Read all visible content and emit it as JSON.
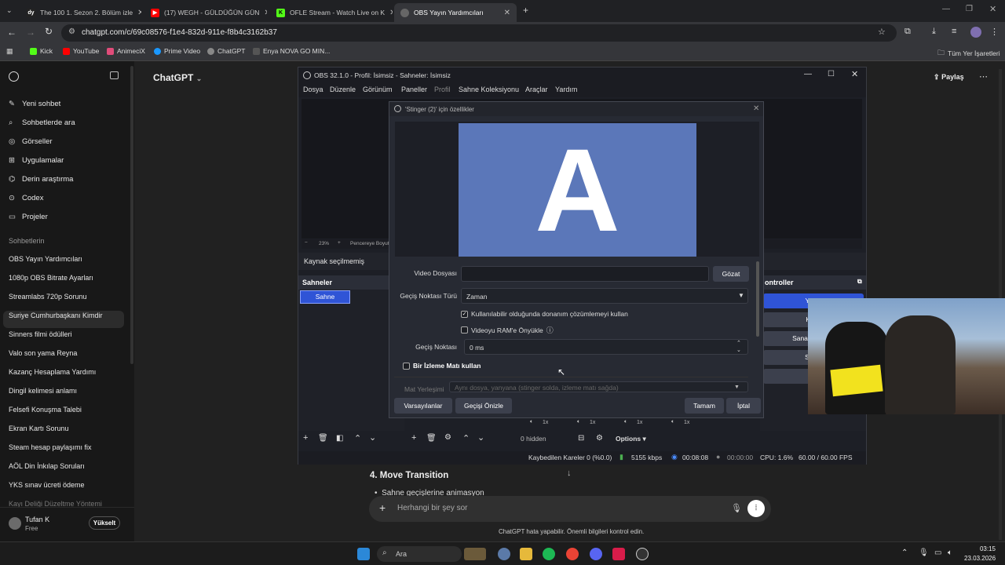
{
  "browser": {
    "tabs": [
      {
        "label": "The 100 1. Sezon 2. Bölüm izle",
        "color": "#222"
      },
      {
        "label": "(17) WEGH - GÜLDÜĞÜN GÜN",
        "color": "#ff0000"
      },
      {
        "label": "OFLE Stream - Watch Live on K",
        "color": "#53fc18"
      },
      {
        "label": "OBS Yayın Yardımcıları",
        "color": "#888"
      }
    ],
    "url": "chatgpt.com/c/69c08576-f1e4-832d-911e-f8b4c3162b37",
    "bookmarks": [
      "Kick",
      "YouTube",
      "AnimeciX",
      "Prime Video",
      "ChatGPT",
      "Enya NOVA GO MIN..."
    ],
    "all_bookmarks": "Tüm Yer İşaretleri"
  },
  "sidebar": {
    "actions": [
      "Yeni sohbet",
      "Sohbetlerde ara",
      "Görseller",
      "Uygulamalar",
      "Derin araştırma",
      "Codex",
      "Projeler"
    ],
    "section_title": "Sohbetlerin",
    "chats": [
      "OBS Yayın Yardımcıları",
      "1080p OBS Bitrate Ayarları",
      "Streamlabs 720p Sorunu",
      "Suriye Cumhurbaşkanı Kimdir",
      "Sinners filmi ödülleri",
      "Valo son yama Reyna",
      "Kazanç Hesaplama Yardımı",
      "Dingil kelimesi anlamı",
      "Felsefi Konuşma Talebi",
      "Ekran Kartı Sorunu",
      "Steam hesap paylaşımı fix",
      "AÖL Din İnkılap Soruları",
      "YKS sınav ücreti ödeme",
      "Kayı Deliği Düzeltme Yöntemi"
    ],
    "user_name": "Tufan K",
    "user_plan": "Free",
    "upgrade": "Yükselt"
  },
  "main": {
    "title": "ChatGPT",
    "share": "Paylaş",
    "heading": "4. Move Transition",
    "bullet": "Sahne geçişlerine animasyon",
    "composer_placeholder": "Herhangi bir şey sor",
    "disclaimer": "ChatGPT hata yapabilir. Önemli bilgileri kontrol edin."
  },
  "obs": {
    "title": "OBS 32.1.0 - Profil: İsimsiz - Sahneler: İsimsiz",
    "menu": [
      "Dosya",
      "Düzenle",
      "Görünüm",
      "Paneller",
      "Profil",
      "Sahne Koleksiyonu",
      "Araçlar",
      "Yardım"
    ],
    "zoom": "23%",
    "fit_label": "Pencereye Boyutl",
    "no_source": "Kaynak seçilmemiş",
    "scenes_header": "Sahneler",
    "scene_name": "Sahne",
    "controls_header": "ontroller",
    "controls": [
      "Yayın",
      "Kayd",
      "Sanal Kamera",
      "Stüdy",
      "Ay"
    ],
    "hidden": "0 hidden",
    "options": "Options",
    "mixer_labels": [
      "1x",
      "1x",
      "1x",
      "1x"
    ],
    "status": {
      "dropped": "Kaybedilen Kareler 0 (%0.0)",
      "bitrate": "5155 kbps",
      "stream_time": "00:08:08",
      "rec_time": "00:00:00",
      "cpu": "CPU: 1.6%",
      "fps": "60.00 / 60.00 FPS"
    }
  },
  "dialog": {
    "title": "'Stinger (2)' için özellikler",
    "preview_letter": "A",
    "video_label": "Video Dosyası",
    "video_value": "",
    "browse": "Gözat",
    "point_type_label": "Geçiş Noktası Türü",
    "point_type_value": "Zaman",
    "hw_decode": "Kullanılabilir olduğunda donanım çözümlemeyi kullan",
    "hw_decode_checked": true,
    "preload": "Videoyu RAM'e Önyükle",
    "preload_checked": false,
    "point_label": "Geçiş Noktası",
    "point_value": "0 ms",
    "matte_label": "Bir İzleme Matı kullan",
    "matte_pos_label": "Mat Yerleşimi",
    "matte_pos_value": "Aynı dosya, yanyana (stinger solda, izleme matı sağda)",
    "defaults": "Varsayılanlar",
    "preview_btn": "Geçişi Önizle",
    "ok": "Tamam",
    "cancel": "İptal"
  },
  "taskbar": {
    "search": "Ara",
    "time": "03:15",
    "date": "23.03.2026"
  },
  "colors": {
    "accent_blue": "#2f54d6",
    "preview_blue": "#5b77b9"
  }
}
